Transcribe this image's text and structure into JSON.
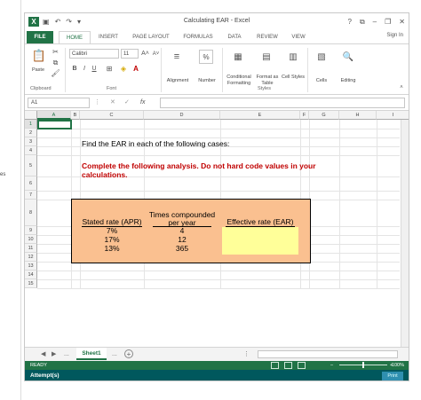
{
  "window": {
    "title": "Calculating EAR - Excel",
    "sign_in": "Sign In"
  },
  "left_fragment": "es",
  "tabs": [
    "FILE",
    "HOME",
    "INSERT",
    "PAGE LAYOUT",
    "FORMULAS",
    "DATA",
    "REVIEW",
    "VIEW"
  ],
  "active_tab": "HOME",
  "ribbon": {
    "paste": "Paste",
    "clipboard": "Clipboard",
    "font_name": "Calibri",
    "font_size": "11",
    "font_group": "Font",
    "alignment": "Alignment",
    "number": "Number",
    "conditional_formatting": "Conditional Formatting",
    "format_as_table": "Format as Table",
    "cell_styles": "Cell Styles",
    "styles": "Styles",
    "cells": "Cells",
    "editing": "Editing",
    "bold": "B",
    "italic": "I",
    "underline": "U",
    "percent": "%"
  },
  "formula_bar": {
    "name_box": "A1",
    "fx": "fx",
    "cancel": "✕",
    "enter": "✓",
    "value": ""
  },
  "columns": [
    "A",
    "B",
    "C",
    "D",
    "E",
    "F",
    "G",
    "H",
    "I"
  ],
  "rows": [
    "1",
    "2",
    "3",
    "4",
    "5",
    "6",
    "7",
    "8",
    "9",
    "10",
    "11",
    "12",
    "13",
    "14",
    "15"
  ],
  "sheet": {
    "instruction": "Find the EAR in each of the following cases:",
    "note": "Complete the following analysis. Do not hard code values in your calculations.",
    "table": {
      "headers": {
        "stated_rate": "Stated rate (APR)",
        "times_compounded": "Times compounded per year",
        "effective_rate": "Effective rate (EAR)"
      },
      "rows": [
        {
          "apr": "7%",
          "times": "4"
        },
        {
          "apr": "17%",
          "times": "12"
        },
        {
          "apr": "13%",
          "times": "365"
        }
      ]
    }
  },
  "sheet_tabs": {
    "active": "Sheet1",
    "more": "...",
    "add": "+"
  },
  "status": {
    "ready": "READY",
    "zoom": "100%"
  },
  "footer": {
    "attempts": "Attempt(s)",
    "print": "Print"
  },
  "colors": {
    "excel_green": "#217346",
    "orange_fill": "#fac090",
    "yellow_fill": "#ffff99",
    "red_text": "#c00000",
    "footer_teal": "#00585d"
  }
}
